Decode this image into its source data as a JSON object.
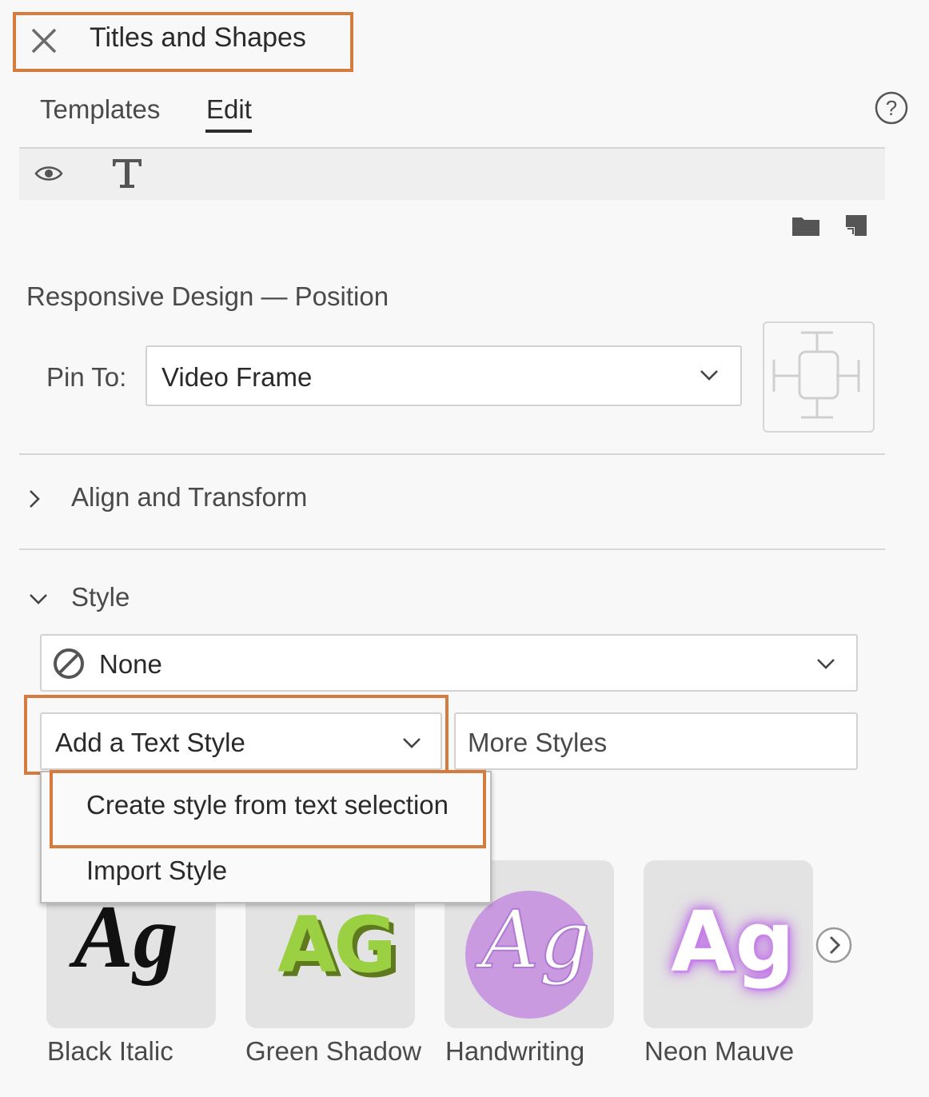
{
  "header": {
    "title": "Titles and Shapes"
  },
  "tabs": [
    {
      "label": "Templates"
    },
    {
      "label": "Edit"
    }
  ],
  "responsive": {
    "title": "Responsive Design — Position",
    "pin_label": "Pin To:",
    "pin_value": "Video Frame"
  },
  "align_section": {
    "title": "Align and Transform"
  },
  "style_section": {
    "title": "Style",
    "style_value": "None",
    "add_text_style": "Add a Text Style",
    "more_styles": "More Styles"
  },
  "menu": {
    "items": [
      {
        "label": "Create style from text selection"
      },
      {
        "label": "Import Style"
      }
    ]
  },
  "styles": [
    {
      "label": "Black Italic",
      "glyph": "Ag"
    },
    {
      "label": "Green Shadow",
      "glyph": "AG"
    },
    {
      "label": "Handwriting",
      "glyph": "Ag"
    },
    {
      "label": "Neon Mauve",
      "glyph": "Ag"
    }
  ],
  "colors": {
    "highlight": "#d67b3e",
    "panel_bg": "#f8f8f8",
    "green_style": "#9bd042",
    "mauve_style": "#c99ae0"
  },
  "icons": [
    "close-icon",
    "help-icon",
    "eye-icon",
    "text-tool-icon",
    "folder-icon",
    "new-item-icon",
    "chevron-down-icon",
    "chevron-right-icon",
    "none-icon",
    "position-pin-icon",
    "next-arrow-icon"
  ]
}
